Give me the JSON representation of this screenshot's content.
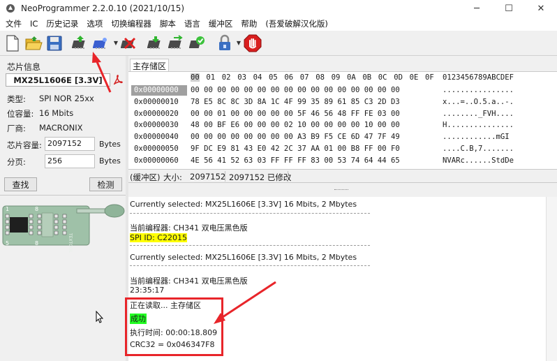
{
  "window": {
    "title": "NeoProgrammer 2.2.0.10 (2021/10/15)",
    "minimize": "─",
    "maximize": "☐",
    "close": "✕"
  },
  "menu": [
    "文件",
    "IC",
    "历史记录",
    "选项",
    "切换编程器",
    "脚本",
    "语言",
    "缓冲区",
    "帮助",
    "(吾爱破解汉化版)"
  ],
  "toolbar": {
    "buttons": [
      "new-file",
      "open-file",
      "save-file",
      "read-chip",
      "chip-select",
      "erase-chip",
      "write-chip",
      "verify-chip",
      "auto-program",
      "protect-lock",
      "stop"
    ]
  },
  "chip_info": {
    "group_label": "芯片信息",
    "name": "MX25L1606E [3.3V]",
    "type_label": "类型:",
    "type_value": "SPI NOR 25xx",
    "capacity_label": "位容量:",
    "capacity_value": "16 Mbits",
    "vendor_label": "厂商:",
    "vendor_value": "MACRONIX",
    "chip_size_label": "芯片容量:",
    "chip_size_value": "2097152",
    "chip_size_unit": "Bytes",
    "page_label": "分页:",
    "page_value": "256",
    "page_unit": "Bytes",
    "find_button": "查找",
    "detect_button": "检测",
    "socket_label": "TEXTOOL",
    "socket_pin_left": "1",
    "socket_pin_right": "8",
    "socket_pin_bottom_left": "5",
    "socket_pin_bottom_right": "8"
  },
  "buffer": {
    "tab": "主存储区",
    "header_offsets": [
      "00",
      "01",
      "02",
      "03",
      "04",
      "05",
      "06",
      "07",
      "08",
      "09",
      "0A",
      "0B",
      "0C",
      "0D",
      "0E",
      "0F"
    ],
    "header_ascii": "0123456789ABCDEF",
    "rows": [
      {
        "addr": "0x00000000",
        "bytes": "00 00 00 00 00 00 00 00 00 00 00 00 00 00 00 00",
        "ascii": "................",
        "selected": true
      },
      {
        "addr": "0x00000010",
        "bytes": "78 E5 8C 8C 3D 8A 1C 4F 99 35 89 61 85 C3 2D D3",
        "ascii": "x...=..O.5.a..-.",
        "selected": false
      },
      {
        "addr": "0x00000020",
        "bytes": "00 00 01 00 00 00 00 00 5F 46 56 48 FF FE 03 00",
        "ascii": "........_FVH....",
        "selected": false
      },
      {
        "addr": "0x00000030",
        "bytes": "48 00 BF E6 00 00 00 02 10 00 00 00 00 10 00 00",
        "ascii": "H...............",
        "selected": false
      },
      {
        "addr": "0x00000040",
        "bytes": "00 00 00 00 00 00 00 00 A3 B9 F5 CE 6D 47 7F 49",
        "ascii": "............mGI",
        "selected": false
      },
      {
        "addr": "0x00000050",
        "bytes": "9F DC E9 81 43 E0 42 2C 37 AA 01 00 B8 FF 00 F0",
        "ascii": "....C.B,7.......",
        "selected": false
      },
      {
        "addr": "0x00000060",
        "bytes": "4E 56 41 52 63 03 FF FF FF 83 00 53 74 64 44 65",
        "ascii": "NVARc......StdDe",
        "selected": false
      }
    ],
    "status_region": "(缓冲区)",
    "status_size_label": "大小:",
    "status_size_value": "2097152",
    "status_modified": "2097152 已修改"
  },
  "log": {
    "lines": [
      {
        "text": "Currently selected: MX25L1606E [3.3V] 16 Mbits, 2 Mbytes",
        "style": "normal"
      },
      {
        "text": "当前编程器: CH341 双电压黑色版",
        "style": "normal"
      },
      {
        "text": "SPI ID: C22015",
        "style": "yellow"
      },
      {
        "text": "Currently selected: MX25L1606E [3.3V] 16 Mbits, 2 Mbytes",
        "style": "normal"
      },
      {
        "text": "当前编程器: CH341 双电压黑色版",
        "style": "normal"
      },
      {
        "text": "23:35:17",
        "style": "normal"
      },
      {
        "text": "正在读取... 主存储区",
        "style": "normal"
      },
      {
        "text": "成功",
        "style": "green"
      },
      {
        "text": "执行时间:  00:00:18.809",
        "style": "normal"
      },
      {
        "text": "CRC32 = 0x046347F8",
        "style": "normal"
      }
    ]
  },
  "colors": {
    "annotation_red": "#e8252a",
    "success_green": "#22ff22",
    "highlight_yellow": "#ffff00"
  }
}
